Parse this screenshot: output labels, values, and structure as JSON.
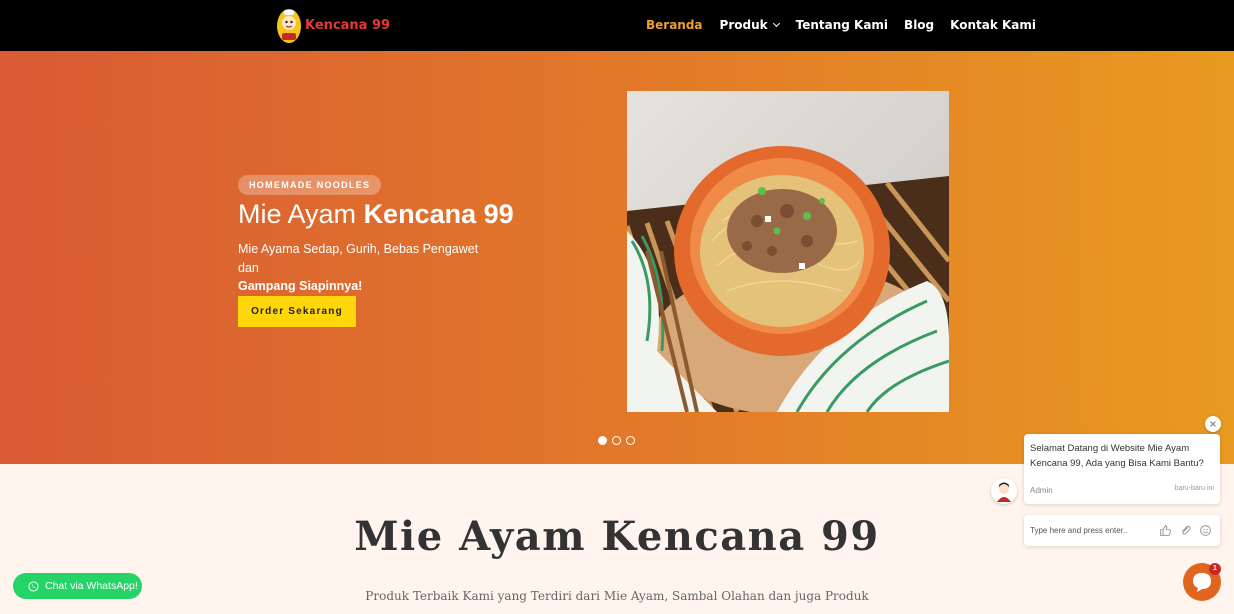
{
  "brand": {
    "name": "Kencana 99"
  },
  "nav": {
    "items": [
      {
        "label": "Beranda",
        "active": true
      },
      {
        "label": "Produk",
        "has_dropdown": true
      },
      {
        "label": "Tentang Kami"
      },
      {
        "label": "Blog"
      },
      {
        "label": "Kontak Kami"
      }
    ]
  },
  "hero": {
    "badge": "HOMEMADE NOODLES",
    "title_light": "Mie Ayam",
    "title_bold": "Kencana 99",
    "subtitle_line1": "Mie Ayama Sedap, Gurih, Bebas Pengawet dan",
    "subtitle_bold": "Gampang Siapinnya!",
    "cta_label": "Order Sekarang",
    "slides": {
      "count": 3,
      "active": 1
    }
  },
  "section": {
    "title": "Mie Ayam Kencana 99",
    "description": "Produk Terbaik Kami yang Terdiri dari Mie Ayam, Sambal Olahan dan juga Produk"
  },
  "whatsapp": {
    "label": "Chat via WhatsApp!"
  },
  "chat": {
    "message": "Selamat Datang di Website Mie Ayam Kencana 99, Ada yang Bisa Kami Bantu?",
    "sender": "Admin",
    "time": "baru-baru ini",
    "input_placeholder": "Type here and press enter..",
    "unread_count": "1"
  },
  "colors": {
    "header_bg": "#000000",
    "nav_active": "#f0a030",
    "hero_gradient_start": "#d95a34",
    "hero_gradient_end": "#e89a20",
    "cta_bg": "#ffd60a",
    "whatsapp_green": "#25d366",
    "chat_fab": "#e0661f"
  }
}
